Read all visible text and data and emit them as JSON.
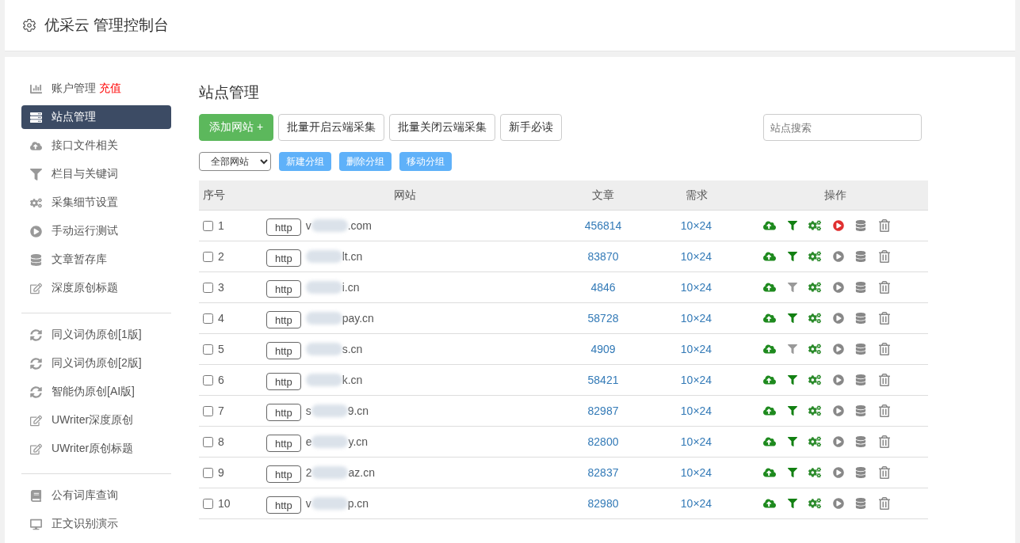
{
  "header": {
    "title": "优采云 管理控制台"
  },
  "sidebar": {
    "groups": [
      [
        {
          "label": "账户管理",
          "badge": "充值",
          "selected": false
        },
        {
          "label": "站点管理",
          "selected": true
        },
        {
          "label": "接口文件相关",
          "selected": false
        },
        {
          "label": "栏目与关键词",
          "selected": false
        },
        {
          "label": "采集细节设置",
          "selected": false
        },
        {
          "label": "手动运行测试",
          "selected": false
        },
        {
          "label": "文章暂存库",
          "selected": false
        },
        {
          "label": "深度原创标题",
          "selected": false
        }
      ],
      [
        {
          "label": "同义词伪原创[1版]",
          "selected": false
        },
        {
          "label": "同义词伪原创[2版]",
          "selected": false
        },
        {
          "label": "智能伪原创[AI版]",
          "selected": false
        },
        {
          "label": "UWriter深度原创",
          "selected": false
        },
        {
          "label": "UWriter原创标题",
          "selected": false
        }
      ],
      [
        {
          "label": "公有词库查询",
          "selected": false
        },
        {
          "label": "正文识别演示",
          "selected": false
        }
      ]
    ]
  },
  "page_title": "站点管理",
  "toolbar": {
    "add_button": "添加网站 +",
    "buttons": [
      "批量开启云端采集",
      "批量关闭云端采集",
      "新手必读"
    ],
    "search": {
      "placeholder": "站点搜索"
    }
  },
  "group_bar": {
    "select_value": "全部网站",
    "buttons": [
      "新建分组",
      "删除分组",
      "移动分组"
    ]
  },
  "table": {
    "columns": [
      "序号",
      "网站",
      "文章",
      "需求",
      "操作"
    ],
    "rows": [
      {
        "index": "1",
        "checked": false,
        "protocol": "http",
        "domain_start": "v",
        "domain_end": ".com",
        "articles": "456814",
        "demand": "10×24",
        "filter_on": true,
        "running": true
      },
      {
        "index": "2",
        "checked": false,
        "protocol": "http",
        "domain_start": "",
        "domain_end": "lt.cn",
        "articles": "83870",
        "demand": "10×24",
        "filter_on": true,
        "running": false
      },
      {
        "index": "3",
        "checked": false,
        "protocol": "http",
        "domain_start": "",
        "domain_end": "i.cn",
        "articles": "4846",
        "demand": "10×24",
        "filter_on": false,
        "running": false
      },
      {
        "index": "4",
        "checked": false,
        "protocol": "http",
        "domain_start": "",
        "domain_end": "pay.cn",
        "articles": "58728",
        "demand": "10×24",
        "filter_on": true,
        "running": false
      },
      {
        "index": "5",
        "checked": false,
        "protocol": "http",
        "domain_start": "",
        "domain_end": "s.cn",
        "articles": "4909",
        "demand": "10×24",
        "filter_on": false,
        "running": false
      },
      {
        "index": "6",
        "checked": false,
        "protocol": "http",
        "domain_start": "",
        "domain_end": "k.cn",
        "articles": "58421",
        "demand": "10×24",
        "filter_on": true,
        "running": false
      },
      {
        "index": "7",
        "checked": false,
        "protocol": "http",
        "domain_start": "s",
        "domain_end": "9.cn",
        "articles": "82987",
        "demand": "10×24",
        "filter_on": true,
        "running": false
      },
      {
        "index": "8",
        "checked": false,
        "protocol": "http",
        "domain_start": "e",
        "domain_end": "y.cn",
        "articles": "82800",
        "demand": "10×24",
        "filter_on": true,
        "running": false
      },
      {
        "index": "9",
        "checked": false,
        "protocol": "http",
        "domain_start": "2",
        "domain_end": "az.cn",
        "articles": "82837",
        "demand": "10×24",
        "filter_on": true,
        "running": false
      },
      {
        "index": "10",
        "checked": false,
        "protocol": "http",
        "domain_start": "v",
        "domain_end": "p.cn",
        "articles": "82980",
        "demand": "10×24",
        "filter_on": true,
        "running": false
      }
    ]
  }
}
